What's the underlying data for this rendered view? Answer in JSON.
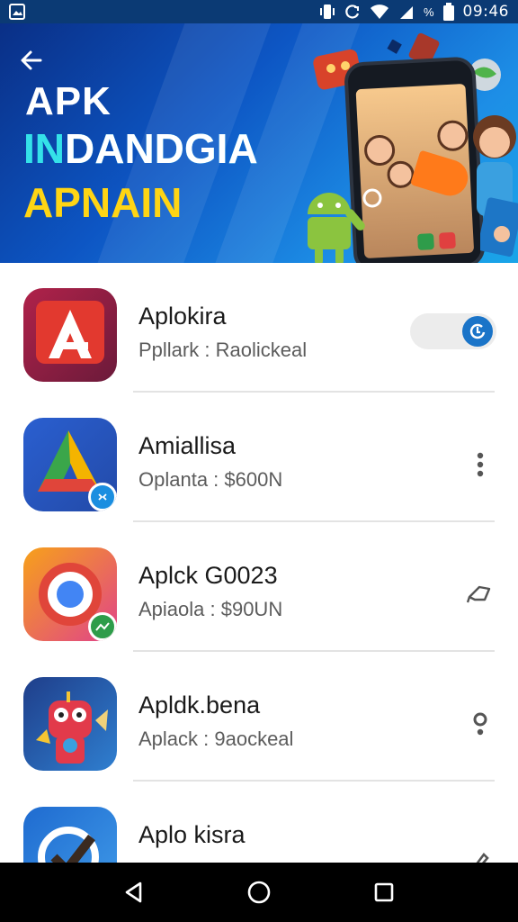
{
  "status_bar": {
    "time": "09:46",
    "battery_label": "%",
    "icons": [
      "photo-icon",
      "vibrate-icon",
      "sync-icon",
      "wifi-icon",
      "signal-icon",
      "battery-icon"
    ]
  },
  "banner": {
    "line1": "APK",
    "line2_accent": "IN",
    "line2_rest": "DANDGIA",
    "line3": "APNAIN",
    "colors": {
      "background": "#0d56c4",
      "line3": "#ffd514",
      "accent": "#35e1e8"
    }
  },
  "apps": [
    {
      "name": "Aplokira",
      "subtitle": "Ppllark : Raolickeal",
      "icon": "red-a-icon",
      "action": "toggle"
    },
    {
      "name": "Amiallisa",
      "subtitle": "Oplanta : $600N",
      "icon": "green-triangle-icon",
      "action": "more-vert-icon"
    },
    {
      "name": "Aplck G0023",
      "subtitle": "Apiaola : $90UN",
      "icon": "chrome-like-icon",
      "action": "pin-icon"
    },
    {
      "name": "Apldk.bena",
      "subtitle": "Aplack : 9aockeal",
      "icon": "robot-game-icon",
      "action": "location-icon"
    },
    {
      "name": "Aplo kisra",
      "subtitle": "",
      "icon": "blue-checkmark-icon",
      "action": "edit-icon"
    }
  ],
  "nav_bar": {
    "icons": [
      "back-icon",
      "home-icon",
      "recents-icon"
    ]
  }
}
